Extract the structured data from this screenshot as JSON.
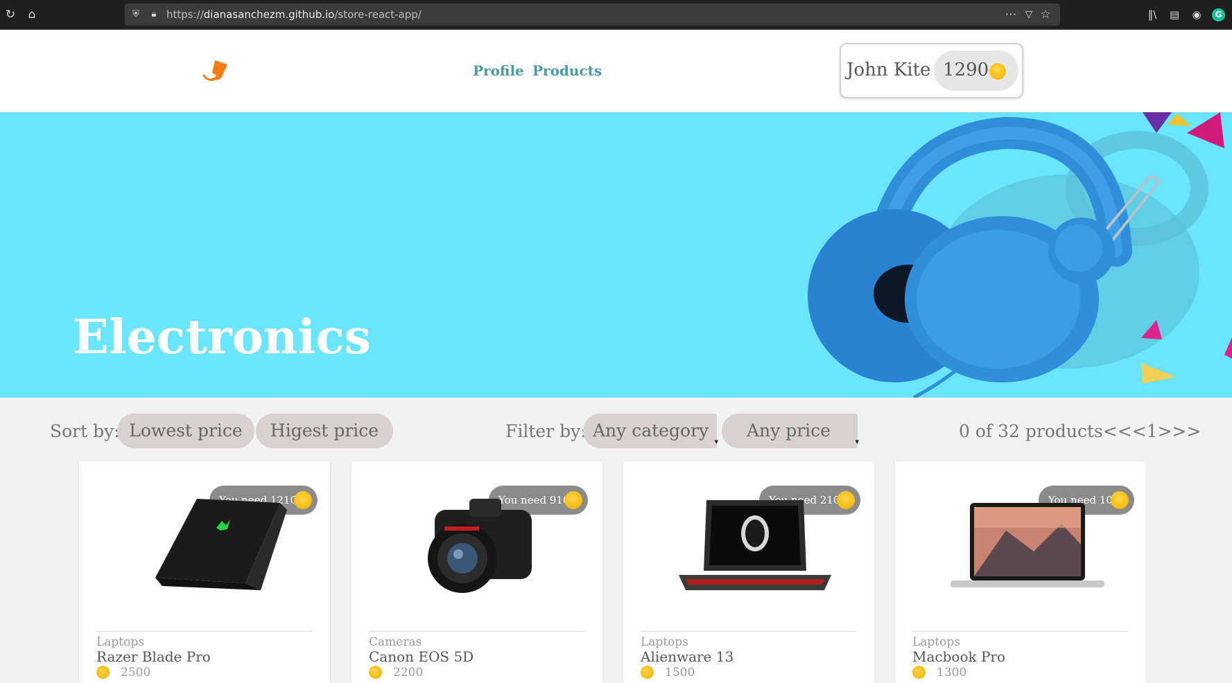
{
  "browser": {
    "url_prefix": "https://",
    "url_host": "dianasanchezm.github.io",
    "url_path": "/store-react-app/",
    "reload_icon": "reload-icon",
    "home_icon": "home-icon"
  },
  "header": {
    "nav": [
      {
        "label": "Profile"
      },
      {
        "label": "Products"
      }
    ],
    "user": {
      "name": "John Kite",
      "points": "1290"
    }
  },
  "banner": {
    "title": "Electronics"
  },
  "toolbar": {
    "sort_label": "Sort by:",
    "sort_options": [
      "Lowest price",
      "Higest price"
    ],
    "filter_label": "Filter by:",
    "category_select": "Any category",
    "price_select": "Any price",
    "pager": "0 of 32 products<<<1>>>"
  },
  "products": [
    {
      "need": "You need 1210",
      "category": "Laptops",
      "name": "Razer Blade Pro",
      "price": "2500"
    },
    {
      "need": "You need 910",
      "category": "Cameras",
      "name": "Canon EOS 5D",
      "price": "2200"
    },
    {
      "need": "You need 210",
      "category": "Laptops",
      "name": "Alienware 13",
      "price": "1500"
    },
    {
      "need": "You need 10",
      "category": "Laptops",
      "name": "Macbook Pro",
      "price": "1300"
    }
  ],
  "colors": {
    "accent": "#4b9aa2",
    "banner": "#6ae5fb",
    "coin": "#f7be16",
    "pill": "#d9d0d0"
  }
}
